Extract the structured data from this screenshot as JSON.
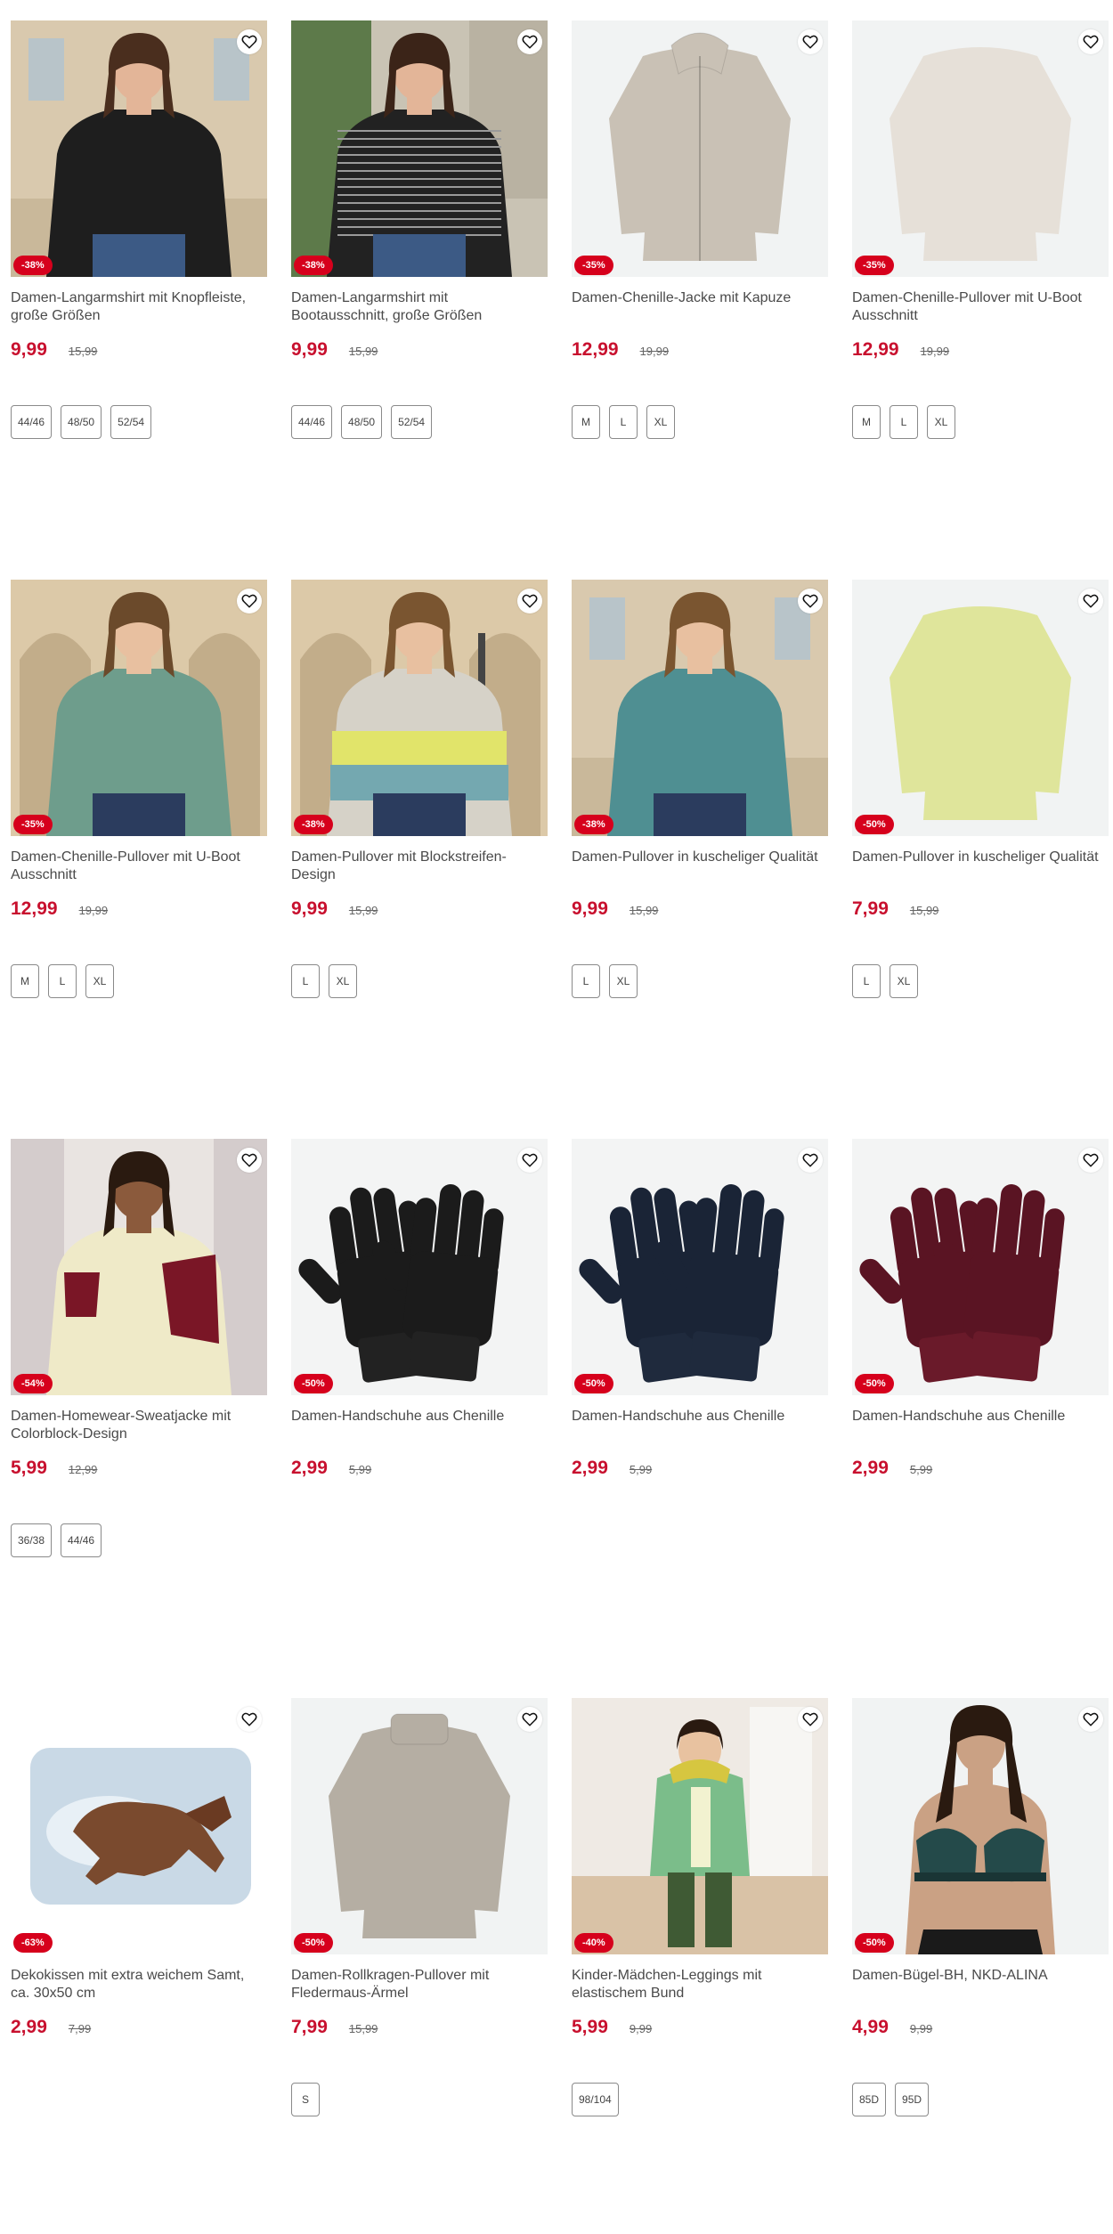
{
  "colors": {
    "sale_badge": "#d6001c",
    "price": "#c8102e"
  },
  "products": [
    {
      "title": "Damen-Langarmshirt mit Knopfleiste, große Größen",
      "price": "9,99",
      "old_price": "15,99",
      "discount": "-38%",
      "sizes": [
        "44/46",
        "48/50",
        "52/54"
      ],
      "image": "woman-black-cardigan"
    },
    {
      "title": "Damen-Langarmshirt mit Bootausschnitt, große Größen",
      "price": "9,99",
      "old_price": "15,99",
      "discount": "-38%",
      "sizes": [
        "44/46",
        "48/50",
        "52/54"
      ],
      "image": "woman-striped-shirt"
    },
    {
      "title": "Damen-Chenille-Jacke mit Kapuze",
      "price": "12,99",
      "old_price": "19,99",
      "discount": "-35%",
      "sizes": [
        "M",
        "L",
        "XL"
      ],
      "image": "beige-hooded-jacket"
    },
    {
      "title": "Damen-Chenille-Pullover mit U-Boot Ausschnitt",
      "price": "12,99",
      "old_price": "19,99",
      "discount": "-35%",
      "sizes": [
        "M",
        "L",
        "XL"
      ],
      "image": "cream-pullover"
    },
    {
      "title": "Damen-Chenille-Pullover mit U-Boot Ausschnitt",
      "price": "12,99",
      "old_price": "19,99",
      "discount": "-35%",
      "sizes": [
        "M",
        "L",
        "XL"
      ],
      "image": "woman-green-pullover"
    },
    {
      "title": "Damen-Pullover mit Blockstreifen-Design",
      "price": "9,99",
      "old_price": "15,99",
      "discount": "-38%",
      "sizes": [
        "L",
        "XL"
      ],
      "image": "woman-block-stripe-pullover"
    },
    {
      "title": "Damen-Pullover in kuscheliger Qualität",
      "price": "9,99",
      "old_price": "15,99",
      "discount": "-38%",
      "sizes": [
        "L",
        "XL"
      ],
      "image": "woman-teal-pullover"
    },
    {
      "title": "Damen-Pullover in kuscheliger Qualität",
      "price": "7,99",
      "old_price": "15,99",
      "discount": "-50%",
      "sizes": [
        "L",
        "XL"
      ],
      "image": "yellow-pullover"
    },
    {
      "title": "Damen-Homewear-Sweatjacke mit Colorblock-Design",
      "price": "5,99",
      "old_price": "12,99",
      "discount": "-54%",
      "sizes": [
        "36/38",
        "44/46"
      ],
      "image": "woman-homewear-jacket"
    },
    {
      "title": "Damen-Handschuhe aus Chenille",
      "price": "2,99",
      "old_price": "5,99",
      "discount": "-50%",
      "sizes": [],
      "image": "black-gloves"
    },
    {
      "title": "Damen-Handschuhe aus Chenille",
      "price": "2,99",
      "old_price": "5,99",
      "discount": "-50%",
      "sizes": [],
      "image": "navy-gloves"
    },
    {
      "title": "Damen-Handschuhe aus Chenille",
      "price": "2,99",
      "old_price": "5,99",
      "discount": "-50%",
      "sizes": [],
      "image": "burgundy-gloves"
    },
    {
      "title": "Dekokissen mit extra weichem Samt, ca. 30x50 cm",
      "price": "2,99",
      "old_price": "7,99",
      "discount": "-63%",
      "sizes": [],
      "image": "horse-cushion"
    },
    {
      "title": "Damen-Rollkragen-Pullover mit Fledermaus-Ärmel",
      "price": "7,99",
      "old_price": "15,99",
      "discount": "-50%",
      "sizes": [
        "S"
      ],
      "image": "beige-turtleneck"
    },
    {
      "title": "Kinder-Mädchen-Leggings mit elastischem Bund",
      "price": "5,99",
      "old_price": "9,99",
      "discount": "-40%",
      "sizes": [
        "98/104"
      ],
      "image": "girl-leggings"
    },
    {
      "title": "Damen-Bügel-BH, NKD-ALINA",
      "price": "4,99",
      "old_price": "9,99",
      "discount": "-50%",
      "sizes": [
        "85D",
        "95D"
      ],
      "image": "woman-bra"
    }
  ]
}
